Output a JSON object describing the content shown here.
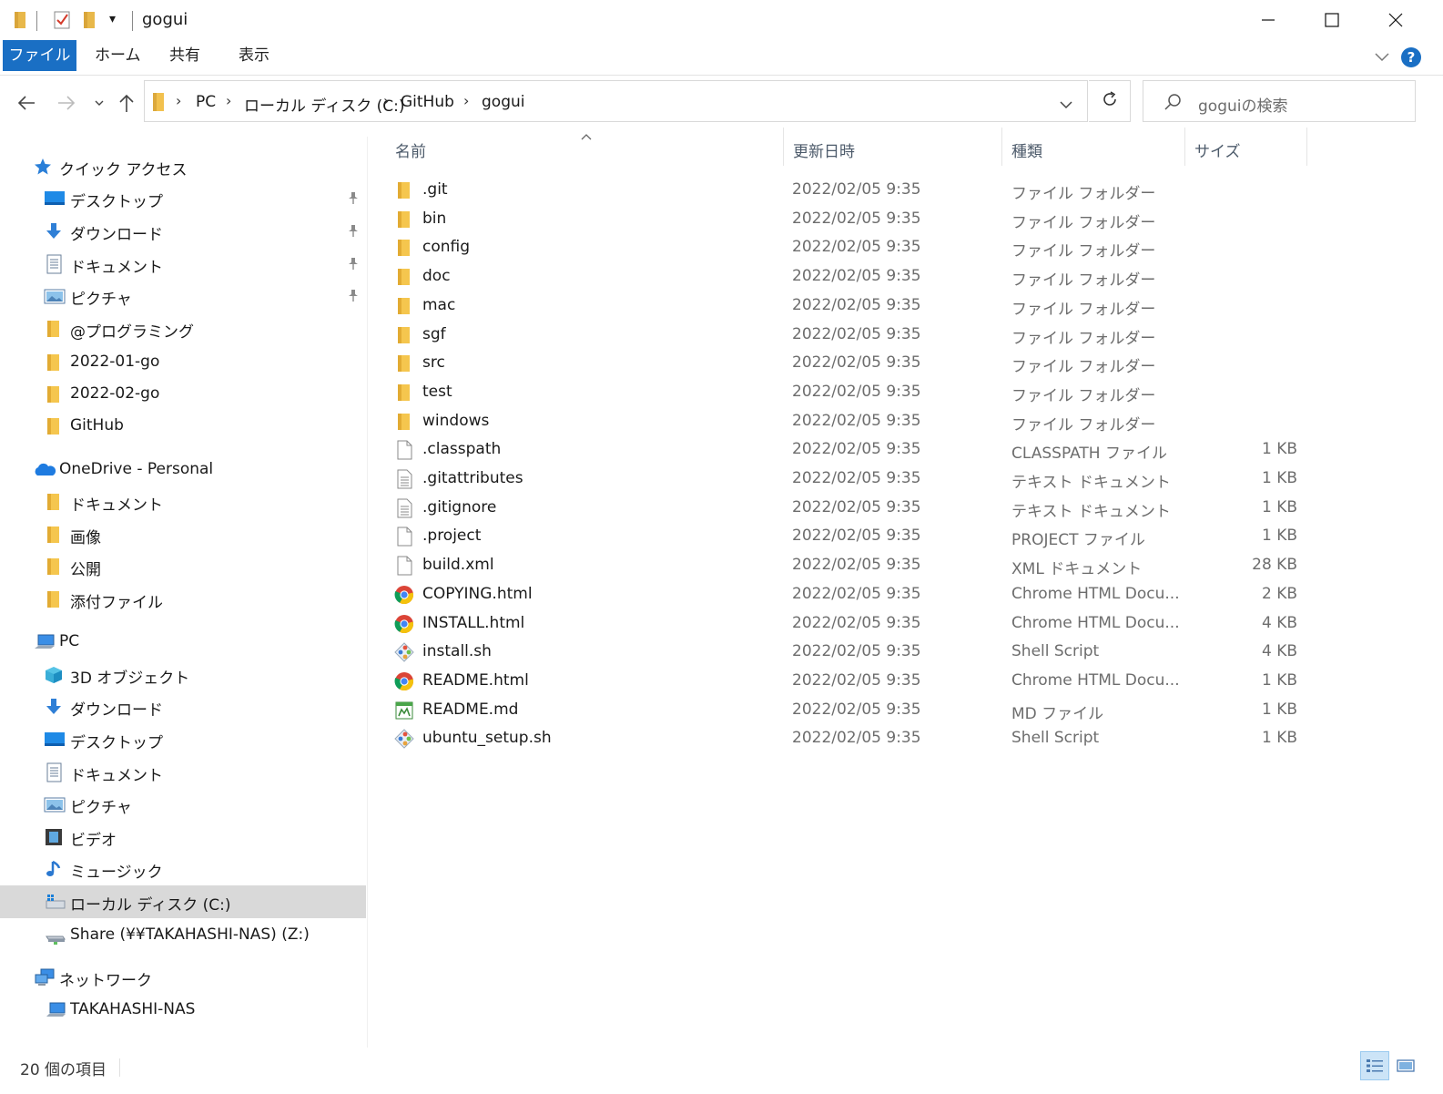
{
  "window": {
    "title": "gogui",
    "qa_dropdown": "▾"
  },
  "ribbon": {
    "tabs": [
      "ファイル",
      "ホーム",
      "共有",
      "表示"
    ],
    "help": "?"
  },
  "address": {
    "crumbs": [
      "PC",
      "ローカル ディスク (C:)",
      "GitHub",
      "gogui"
    ],
    "separator": "›"
  },
  "search": {
    "placeholder": "goguiの検索"
  },
  "sidebar": {
    "items": [
      {
        "label": "クイック アクセス",
        "icon": "quick-access-star-icon",
        "level": 0,
        "pinned": false
      },
      {
        "label": "デスクトップ",
        "icon": "desktop-icon",
        "level": 1,
        "pinned": true
      },
      {
        "label": "ダウンロード",
        "icon": "download-arrow-icon",
        "level": 1,
        "pinned": true
      },
      {
        "label": "ドキュメント",
        "icon": "document-icon",
        "level": 1,
        "pinned": true
      },
      {
        "label": "ピクチャ",
        "icon": "pictures-icon",
        "level": 1,
        "pinned": true
      },
      {
        "label": "@プログラミング",
        "icon": "folder-icon",
        "level": 1,
        "pinned": false
      },
      {
        "label": "2022-01-go",
        "icon": "folder-icon",
        "level": 1,
        "pinned": false
      },
      {
        "label": "2022-02-go",
        "icon": "folder-icon",
        "level": 1,
        "pinned": false
      },
      {
        "label": "GitHub",
        "icon": "folder-icon",
        "level": 1,
        "pinned": false
      },
      {
        "label": "OneDrive - Personal",
        "icon": "onedrive-cloud-icon",
        "level": 0,
        "pinned": false
      },
      {
        "label": "ドキュメント",
        "icon": "folder-icon",
        "level": 1,
        "pinned": false
      },
      {
        "label": "画像",
        "icon": "folder-icon",
        "level": 1,
        "pinned": false
      },
      {
        "label": "公開",
        "icon": "folder-icon",
        "level": 1,
        "pinned": false
      },
      {
        "label": "添付ファイル",
        "icon": "folder-icon",
        "level": 1,
        "pinned": false
      },
      {
        "label": "PC",
        "icon": "pc-icon",
        "level": 0,
        "pinned": false
      },
      {
        "label": "3D オブジェクト",
        "icon": "3d-objects-icon",
        "level": 1,
        "pinned": false
      },
      {
        "label": "ダウンロード",
        "icon": "download-arrow-icon",
        "level": 1,
        "pinned": false
      },
      {
        "label": "デスクトップ",
        "icon": "desktop-icon",
        "level": 1,
        "pinned": false
      },
      {
        "label": "ドキュメント",
        "icon": "document-icon",
        "level": 1,
        "pinned": false
      },
      {
        "label": "ピクチャ",
        "icon": "pictures-icon",
        "level": 1,
        "pinned": false
      },
      {
        "label": "ビデオ",
        "icon": "video-icon",
        "level": 1,
        "pinned": false
      },
      {
        "label": "ミュージック",
        "icon": "music-note-icon",
        "level": 1,
        "pinned": false
      },
      {
        "label": "ローカル ディスク (C:)",
        "icon": "local-disk-icon",
        "level": 1,
        "pinned": false,
        "selected": true
      },
      {
        "label": "Share (¥¥TAKAHASHI-NAS) (Z:)",
        "icon": "network-drive-icon",
        "level": 1,
        "pinned": false
      },
      {
        "label": "ネットワーク",
        "icon": "network-icon",
        "level": 0,
        "pinned": false
      },
      {
        "label": "TAKAHASHI-NAS",
        "icon": "network-computer-icon",
        "level": 1,
        "pinned": false
      }
    ]
  },
  "columns": {
    "name": "名前",
    "modified": "更新日時",
    "type": "種類",
    "size": "サイズ"
  },
  "files": [
    {
      "name": ".git",
      "modified": "2022/02/05 9:35",
      "type": "ファイル フォルダー",
      "size": "",
      "icon": "folder-icon"
    },
    {
      "name": "bin",
      "modified": "2022/02/05 9:35",
      "type": "ファイル フォルダー",
      "size": "",
      "icon": "folder-icon"
    },
    {
      "name": "config",
      "modified": "2022/02/05 9:35",
      "type": "ファイル フォルダー",
      "size": "",
      "icon": "folder-icon"
    },
    {
      "name": "doc",
      "modified": "2022/02/05 9:35",
      "type": "ファイル フォルダー",
      "size": "",
      "icon": "folder-icon"
    },
    {
      "name": "mac",
      "modified": "2022/02/05 9:35",
      "type": "ファイル フォルダー",
      "size": "",
      "icon": "folder-icon"
    },
    {
      "name": "sgf",
      "modified": "2022/02/05 9:35",
      "type": "ファイル フォルダー",
      "size": "",
      "icon": "folder-icon"
    },
    {
      "name": "src",
      "modified": "2022/02/05 9:35",
      "type": "ファイル フォルダー",
      "size": "",
      "icon": "folder-icon"
    },
    {
      "name": "test",
      "modified": "2022/02/05 9:35",
      "type": "ファイル フォルダー",
      "size": "",
      "icon": "folder-icon"
    },
    {
      "name": "windows",
      "modified": "2022/02/05 9:35",
      "type": "ファイル フォルダー",
      "size": "",
      "icon": "folder-icon"
    },
    {
      "name": ".classpath",
      "modified": "2022/02/05 9:35",
      "type": "CLASSPATH ファイル",
      "size": "1 KB",
      "icon": "blank-file-icon"
    },
    {
      "name": ".gitattributes",
      "modified": "2022/02/05 9:35",
      "type": "テキスト ドキュメント",
      "size": "1 KB",
      "icon": "text-file-icon"
    },
    {
      "name": ".gitignore",
      "modified": "2022/02/05 9:35",
      "type": "テキスト ドキュメント",
      "size": "1 KB",
      "icon": "text-file-icon"
    },
    {
      "name": ".project",
      "modified": "2022/02/05 9:35",
      "type": "PROJECT ファイル",
      "size": "1 KB",
      "icon": "blank-file-icon"
    },
    {
      "name": "build.xml",
      "modified": "2022/02/05 9:35",
      "type": "XML ドキュメント",
      "size": "28 KB",
      "icon": "blank-file-icon"
    },
    {
      "name": "COPYING.html",
      "modified": "2022/02/05 9:35",
      "type": "Chrome HTML Docu...",
      "size": "2 KB",
      "icon": "chrome-icon"
    },
    {
      "name": "INSTALL.html",
      "modified": "2022/02/05 9:35",
      "type": "Chrome HTML Docu...",
      "size": "4 KB",
      "icon": "chrome-icon"
    },
    {
      "name": "install.sh",
      "modified": "2022/02/05 9:35",
      "type": "Shell Script",
      "size": "4 KB",
      "icon": "git-shell-script-icon"
    },
    {
      "name": "README.html",
      "modified": "2022/02/05 9:35",
      "type": "Chrome HTML Docu...",
      "size": "1 KB",
      "icon": "chrome-icon"
    },
    {
      "name": "README.md",
      "modified": "2022/02/05 9:35",
      "type": "MD ファイル",
      "size": "1 KB",
      "icon": "markdown-file-icon"
    },
    {
      "name": "ubuntu_setup.sh",
      "modified": "2022/02/05 9:35",
      "type": "Shell Script",
      "size": "1 KB",
      "icon": "git-shell-script-icon"
    }
  ],
  "status": {
    "count": "20 個の項目"
  },
  "colors": {
    "accent": "#1a6fc4",
    "folder": "#f8d775",
    "selected": "#d9d9d9"
  }
}
